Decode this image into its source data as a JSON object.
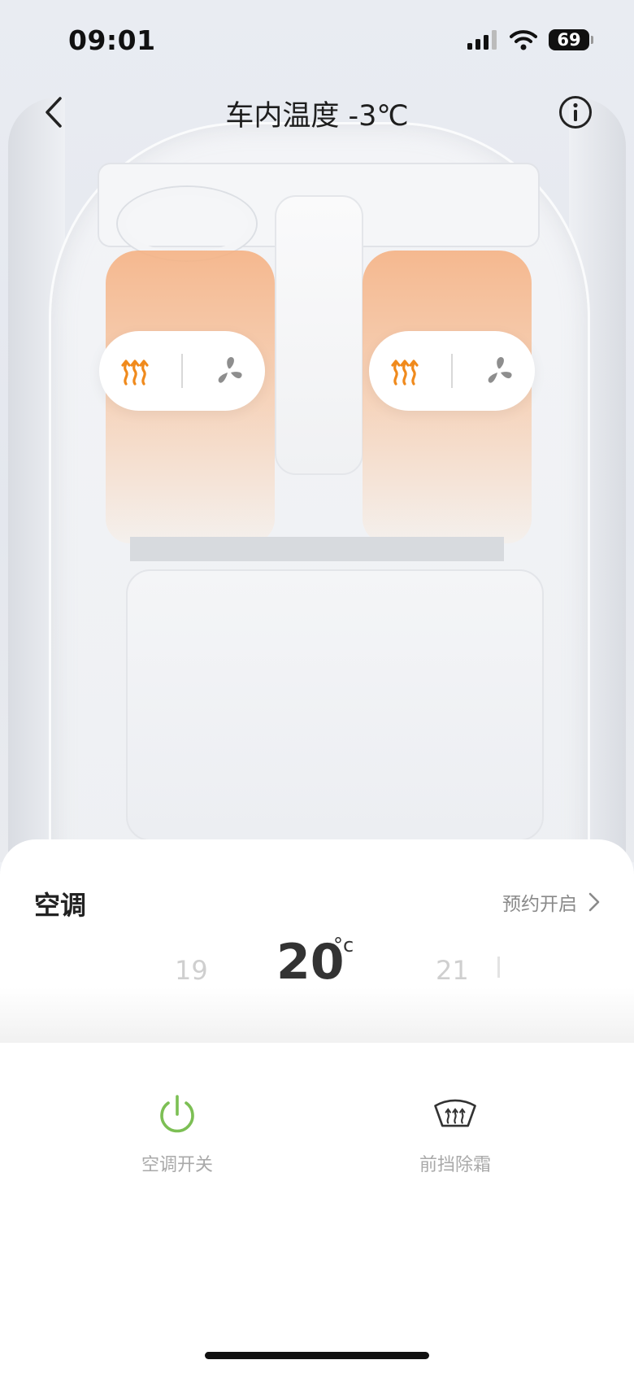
{
  "status_bar": {
    "time": "09:01",
    "battery": "69"
  },
  "nav": {
    "title": "车内温度 -3℃"
  },
  "seats": {
    "left": {
      "heat_icon": "seat-heat-icon",
      "vent_icon": "seat-vent-icon"
    },
    "right": {
      "heat_icon": "seat-heat-icon",
      "vent_icon": "seat-vent-icon"
    }
  },
  "ac_panel": {
    "title": "空调",
    "schedule_label": "预约开启",
    "temperature": {
      "prev": "19",
      "current": "20",
      "unit": "°c",
      "next": "21"
    },
    "actions": {
      "power_label": "空调开关",
      "defrost_label": "前挡除霜"
    }
  },
  "colors": {
    "heat_orange": "#f08a1c",
    "power_green": "#7cbf54",
    "muted_text": "#a9a9a9"
  }
}
